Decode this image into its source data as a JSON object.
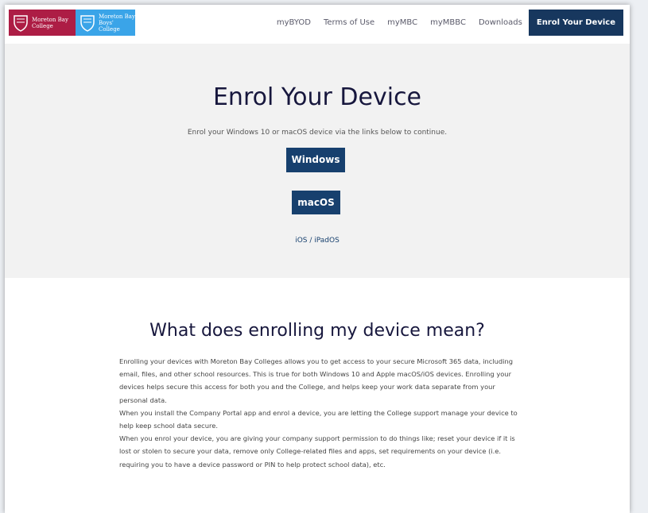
{
  "header": {
    "logos": [
      {
        "name": "Moreton Bay\nCollege",
        "color": "#ad1d45"
      },
      {
        "name": "Moreton Bay\nBoys' College",
        "color": "#3aa4e8"
      }
    ],
    "nav": [
      "myBYOD",
      "Terms of Use",
      "myMBC",
      "myMBBC",
      "Downloads",
      "Enrol Your Device"
    ],
    "active_nav": "Enrol Your Device"
  },
  "hero": {
    "title": "Enrol Your Device",
    "subtitle": "Enrol your Windows 10 or macOS device via the links below to continue.",
    "windows_button": "Windows",
    "macos_button": "macOS",
    "ios_link": "iOS / iPadOS"
  },
  "info": {
    "title": "What does enrolling my device mean?",
    "paragraphs": [
      "Enrolling your devices with Moreton Bay Colleges allows you to get access to your secure Microsoft 365 data, including email, files, and other school resources. This is true for both Windows 10 and Apple macOS/iOS devices. Enrolling your devices helps secure this access for both you and the College, and helps keep your work data separate from your personal data.",
      "When you install the Company Portal app and enrol a device, you are letting the College support manage your device to help keep school data secure.",
      "When you enrol your device, you are giving your company support permission to do things like; reset your device if it is lost or stolen to secure your data, remove only College-related files and apps, set requirements on your device (i.e. requiring you to have a device password or PIN to help protect school data), etc."
    ]
  },
  "colors": {
    "primary": "#17406e",
    "nav_active": "#17375e",
    "hero_bg": "#f2f2f2",
    "heading": "#17173d"
  }
}
